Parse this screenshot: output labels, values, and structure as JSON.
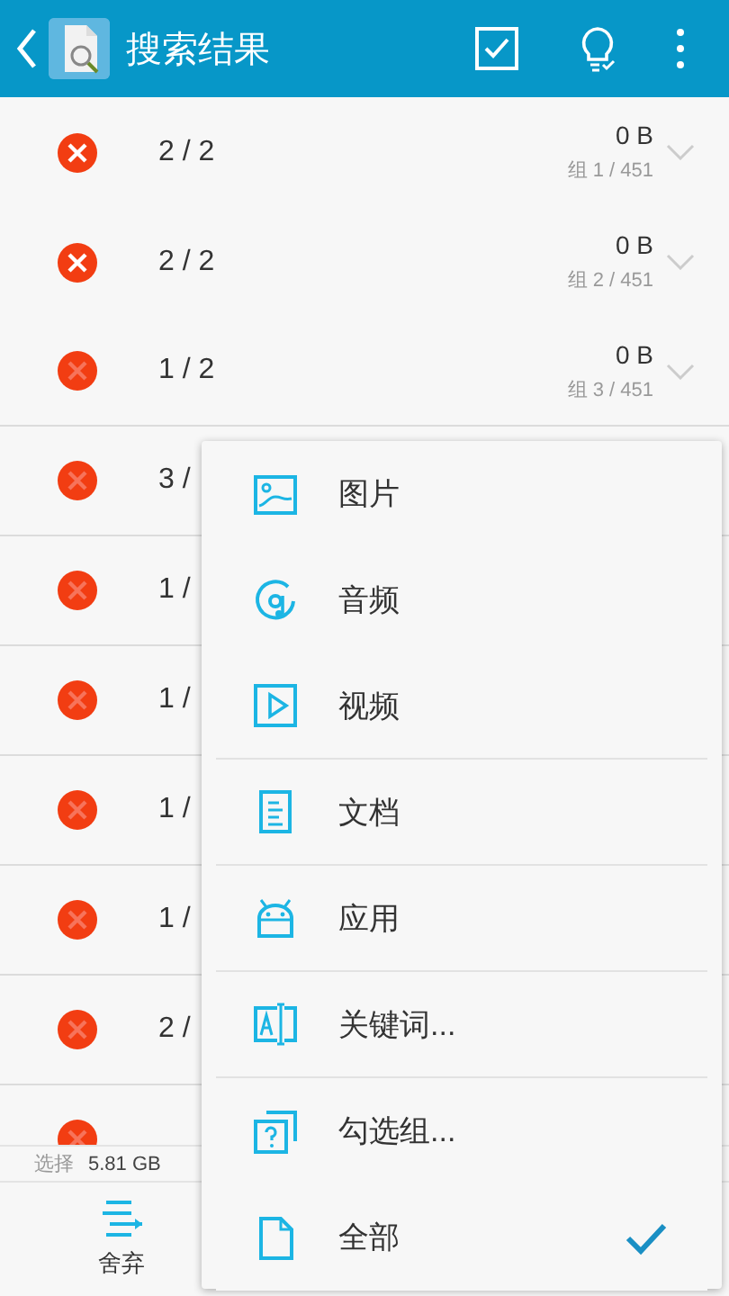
{
  "header": {
    "title": "搜索结果"
  },
  "groups": [
    {
      "count": "2 / 2",
      "size": "0 B",
      "group": "组 1 / 451",
      "active": true
    },
    {
      "count": "2 / 2",
      "size": "0 B",
      "group": "组 2 / 451",
      "active": true
    },
    {
      "count": "1 / 2",
      "size": "0 B",
      "group": "组 3 / 451",
      "active": false
    },
    {
      "count": "3 /",
      "active": false
    },
    {
      "count": "1 /",
      "active": false
    },
    {
      "count": "1 /",
      "active": false
    },
    {
      "count": "1 /",
      "active": false
    },
    {
      "count": "1 /",
      "active": false
    },
    {
      "count": "2 /",
      "active": false
    },
    {
      "active": false
    }
  ],
  "selection": {
    "label": "选择",
    "value": "5.81 GB"
  },
  "bottom_button": {
    "label": "舍弃"
  },
  "menu": [
    {
      "kind": "image",
      "label": "图片",
      "selected": false,
      "divider_after": false
    },
    {
      "kind": "audio",
      "label": "音频",
      "selected": false,
      "divider_after": false
    },
    {
      "kind": "video",
      "label": "视频",
      "selected": false,
      "divider_after": true
    },
    {
      "kind": "document",
      "label": "文档",
      "selected": false,
      "divider_after": true
    },
    {
      "kind": "app",
      "label": "应用",
      "selected": false,
      "divider_after": true
    },
    {
      "kind": "keyword",
      "label": "关键词...",
      "selected": false,
      "divider_after": true
    },
    {
      "kind": "group",
      "label": "勾选组...",
      "selected": false,
      "divider_after": false
    },
    {
      "kind": "all",
      "label": "全部",
      "selected": true,
      "divider_after": false
    }
  ]
}
